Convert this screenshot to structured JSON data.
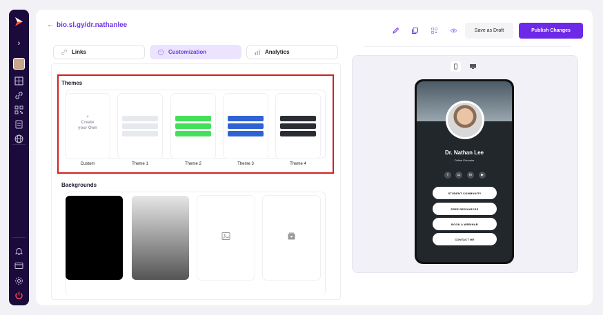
{
  "header": {
    "back_arrow": "←",
    "url": "bio.sl.gy/dr.nathanlee"
  },
  "tabs": [
    {
      "label": "Links",
      "icon": "link-icon"
    },
    {
      "label": "Customization",
      "icon": "palette-icon",
      "active": true
    },
    {
      "label": "Analytics",
      "icon": "bar-chart-icon"
    }
  ],
  "themes": {
    "title": "Themes",
    "create_text": "Create your Own",
    "items": [
      {
        "label": "Custom"
      },
      {
        "label": "Theme 1",
        "color": "#e6e9ee"
      },
      {
        "label": "Theme 2",
        "color": "#45e05a"
      },
      {
        "label": "Theme 3",
        "color": "#2f63d4"
      },
      {
        "label": "Theme 4",
        "color": "#2a2d33"
      }
    ]
  },
  "backgrounds": {
    "title": "Backgrounds",
    "items": [
      {
        "kind": "solid-black"
      },
      {
        "kind": "gradient-gray"
      },
      {
        "kind": "image-icon"
      },
      {
        "kind": "video-icon"
      }
    ]
  },
  "toolbar": {
    "save_draft_label": "Save as Draft",
    "publish_label": "Publish Changes"
  },
  "profile": {
    "name": "Dr. Nathan Lee",
    "subtitle": "Online Educator",
    "socials": [
      "f",
      "◘",
      "in",
      "▶"
    ],
    "links": [
      "STUDENT COMMUNITY",
      "FREE RESOURCES",
      "BOOK A WEBINAR",
      "CONTACT ME"
    ]
  },
  "colors": {
    "accent": "#6d35e8",
    "sidebar": "#1b0b3d",
    "highlight_border": "#d01e1e"
  }
}
